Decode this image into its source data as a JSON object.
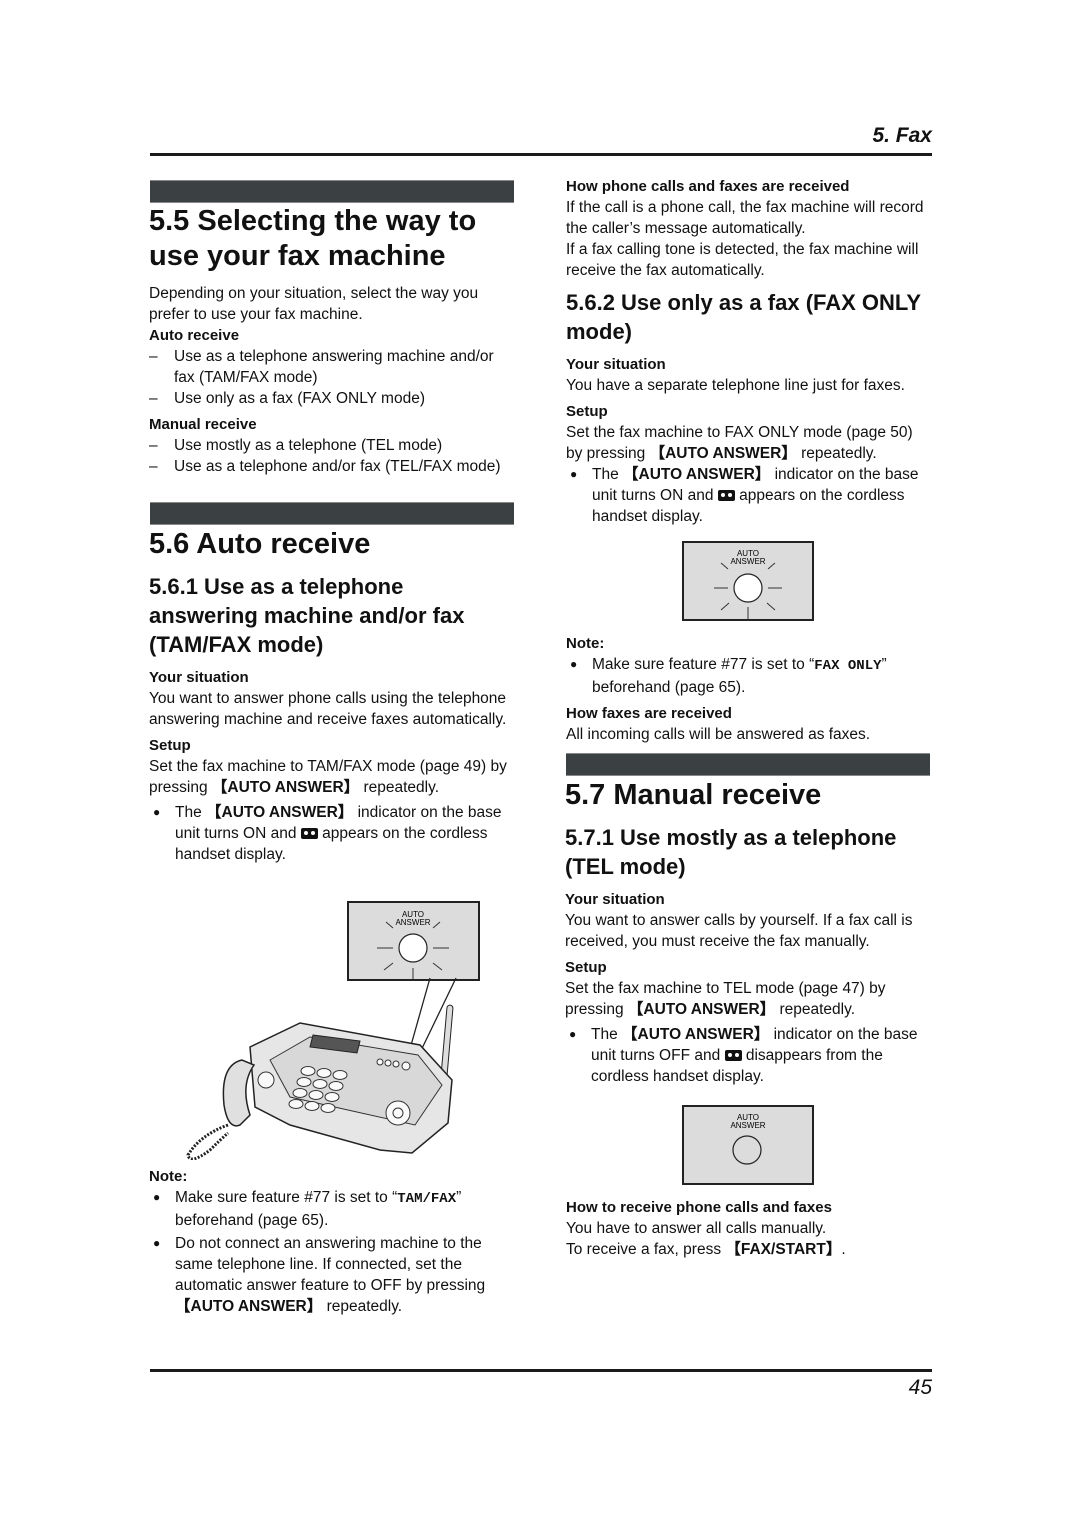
{
  "header": {
    "chapter": "5. Fax"
  },
  "footer": {
    "page_number": "45"
  },
  "sec55": {
    "title_line1": "5.5 Selecting the way to",
    "title_line2": "use your fax machine",
    "intro": "Depending on your situation, select the way you prefer to use your fax machine.",
    "auto_label": "Auto receive",
    "auto_items": [
      "Use as a telephone answering machine and/or fax (TAM/FAX mode)",
      "Use only as a fax (FAX ONLY mode)"
    ],
    "manual_label": "Manual receive",
    "manual_items": [
      "Use mostly as a telephone (TEL mode)",
      "Use as a telephone and/or fax (TEL/FAX mode)"
    ]
  },
  "sec56": {
    "title": "5.6 Auto receive",
    "sub1_title": "5.6.1 Use as a telephone answering machine and/or fax (TAM/FAX mode)",
    "situation_label": "Your situation",
    "situation_text": "You want to answer phone calls using the telephone answering machine and receive faxes automatically.",
    "setup_label": "Setup",
    "setup_pre": "Set the fax machine to TAM/FAX mode (page 49) by pressing ",
    "setup_key": "【AUTO ANSWER】",
    "setup_post": " repeatedly.",
    "bullet_pre": "The ",
    "bullet_key": "【AUTO ANSWER】",
    "bullet_mid": " indicator on the base unit turns ON and ",
    "bullet_post": " appears on the cordless handset display.",
    "panel_label_1": "AUTO",
    "panel_label_2": "ANSWER",
    "note_label": "Note:",
    "note1_pre": "Make sure feature #77 is set to “",
    "note1_code": "TAM/FAX",
    "note1_post": "” beforehand (page 65).",
    "note2_text": "Do not connect an answering machine to the same telephone line. If connected, set the automatic answer feature to OFF by pressing ",
    "note2_key": "【AUTO ANSWER】",
    "note2_post": " repeatedly."
  },
  "right": {
    "how_label": "How phone calls and faxes are received",
    "how_text1": "If the call is a phone call, the fax machine will record the caller’s message automatically.",
    "how_text2": "If a fax calling tone is detected, the fax machine will receive the fax automatically.",
    "sub2_title": "5.6.2 Use only as a fax (FAX ONLY mode)",
    "situation_label": "Your situation",
    "situation_text": "You have a separate telephone line just for faxes.",
    "setup_label": "Setup",
    "setup_pre": "Set the fax machine to FAX ONLY mode (page 50) by pressing ",
    "setup_key": "【AUTO ANSWER】",
    "setup_post": " repeatedly.",
    "bullet_pre": "The ",
    "bullet_key": "【AUTO ANSWER】",
    "bullet_mid": " indicator on the base unit turns ON and ",
    "bullet_post": " appears on the cordless handset display.",
    "panel_label_1": "AUTO",
    "panel_label_2": "ANSWER",
    "note_label": "Note:",
    "note1_pre": "Make sure feature #77 is set to “",
    "note1_code": "FAX ONLY",
    "note1_post": "” beforehand (page 65).",
    "faxes_label": "How faxes are received",
    "faxes_text": "All incoming calls will be answered as faxes."
  },
  "sec57": {
    "title": "5.7 Manual receive",
    "sub1_title": "5.7.1 Use mostly as a telephone (TEL mode)",
    "situation_label": "Your situation",
    "situation_text": "You want to answer calls by yourself. If a fax call is received, you must receive the fax manually.",
    "setup_label": "Setup",
    "setup_pre": "Set the fax machine to TEL mode (page 47) by pressing ",
    "setup_key": "【AUTO ANSWER】",
    "setup_post": " repeatedly.",
    "bullet_pre": "The ",
    "bullet_key": "【AUTO ANSWER】",
    "bullet_mid": " indicator on the base unit turns OFF and ",
    "bullet_post": " disappears from the cordless handset display.",
    "panel_label_1": "AUTO",
    "panel_label_2": "ANSWER",
    "recv_label": "How to receive phone calls and faxes",
    "recv_text1": "You have to answer all calls manually.",
    "recv_pre": "To receive a fax, press ",
    "recv_key": "【FAX/START】",
    "recv_post": "."
  }
}
